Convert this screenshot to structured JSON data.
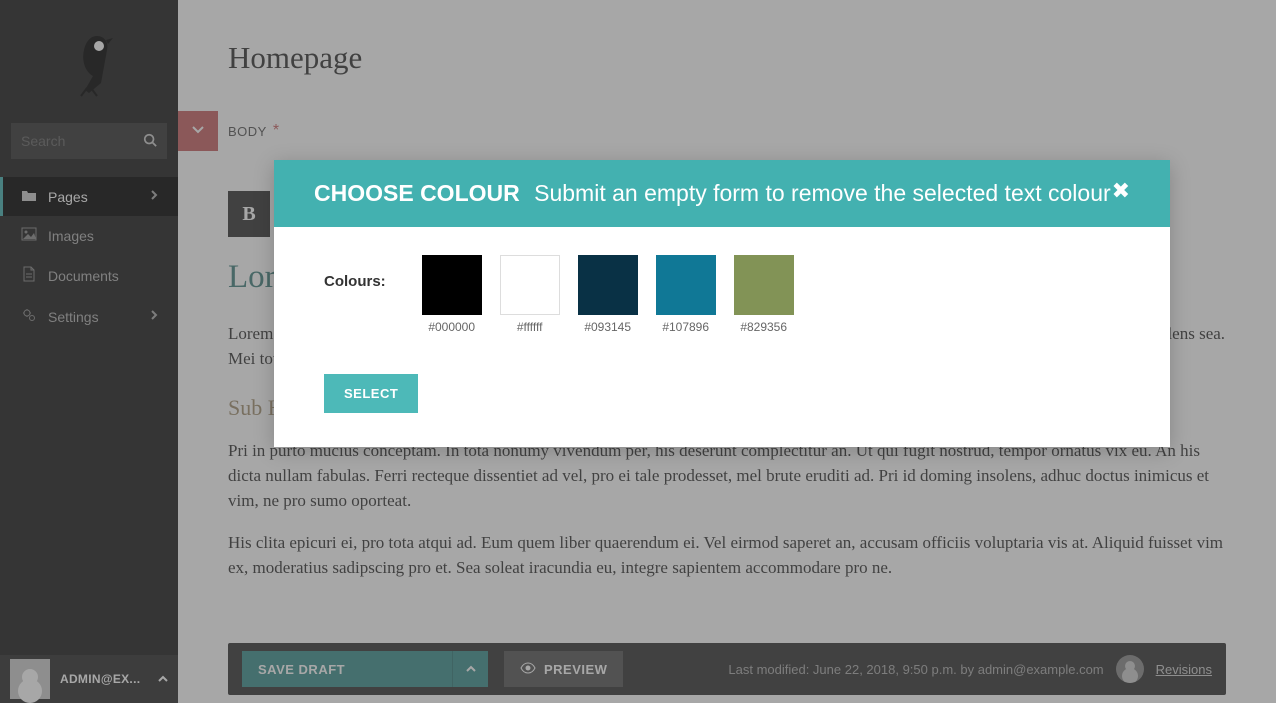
{
  "sidebar": {
    "search_placeholder": "Search",
    "nav": [
      {
        "label": "Pages",
        "icon": "folder-open-icon",
        "active": true,
        "chevron": true
      },
      {
        "label": "Images",
        "icon": "image-icon",
        "active": false,
        "chevron": false
      },
      {
        "label": "Documents",
        "icon": "file-icon",
        "active": false,
        "chevron": false
      },
      {
        "label": "Settings",
        "icon": "cogs-icon",
        "active": false,
        "chevron": true
      }
    ],
    "user_label": "ADMIN@EX..."
  },
  "page": {
    "title": "Homepage",
    "field_label": "BODY",
    "toolbar_bold": "B",
    "h1": "Lorem ipsum",
    "p1": "Lorem ipsum dolor sit amet, eu quo exerci vocibus interesset, te sit tritani noluisse tacimates. Oratio expetenda at mea, et nulla adhuc insolens sea. Mei tota postea et, vis in periculis dignissim, dicta nonumy omnium nec ex.",
    "h2": "Sub Heading",
    "p2": "Pri in purto mucius conceptam. In tota nonumy vivendum per, his deserunt complectitur an. Ut qui fugit nostrud, tempor ornatus vix eu. An his dicta nullam fabulas. Ferri recteque dissentiet ad vel, pro ei tale prodesset, mel brute eruditi ad. Pri id doming insolens, adhuc doctus inimicus et vim, ne pro sumo oporteat.",
    "p3": "His clita epicuri ei, pro tota atqui ad. Eum quem liber quaerendum ei. Vel eirmod saperet an, accusam officiis voluptaria vis at. Aliquid fuisset vim ex, moderatius sadipscing pro et. Sea soleat iracundia eu, integre sapientem accommodare pro ne."
  },
  "actions": {
    "save_label": "SAVE DRAFT",
    "preview_label": "PREVIEW",
    "last_modified": "Last modified: June 22, 2018, 9:50 p.m. by admin@example.com",
    "revisions_label": "Revisions"
  },
  "modal": {
    "title_strong": "CHOOSE COLOUR",
    "title_sub": "Submit an empty form to remove the selected text colour",
    "colours_label": "Colours:",
    "swatches": [
      {
        "hex": "#000000"
      },
      {
        "hex": "#ffffff"
      },
      {
        "hex": "#093145"
      },
      {
        "hex": "#107896"
      },
      {
        "hex": "#829356"
      }
    ],
    "select_label": "SELECT"
  }
}
